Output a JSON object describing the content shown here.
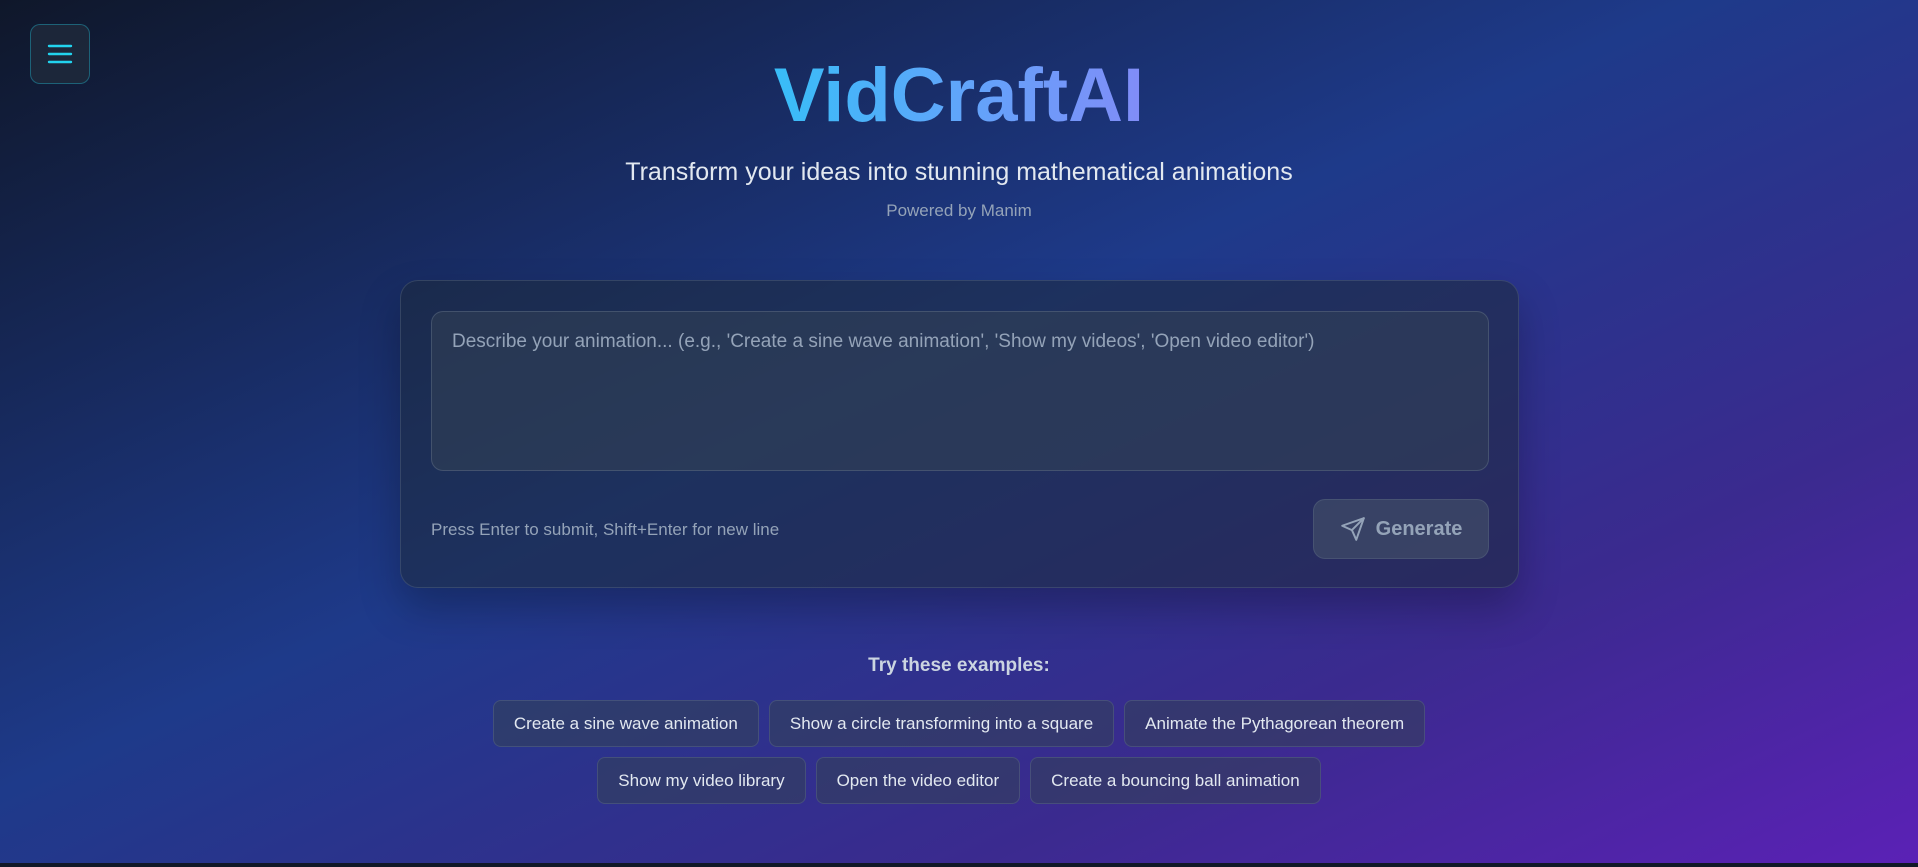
{
  "header": {
    "title": "VidCraftAI",
    "subtitle": "Transform your ideas into stunning mathematical animations",
    "powered_by": "Powered by Manim"
  },
  "menu": {
    "icon": "menu-icon"
  },
  "prompt": {
    "value": "",
    "placeholder": "Describe your animation... (e.g., 'Create a sine wave animation', 'Show my videos', 'Open video editor')",
    "hint": "Press Enter to submit, Shift+Enter for new line",
    "generate_label": "Generate",
    "generate_icon": "send-icon"
  },
  "examples": {
    "heading": "Try these examples:",
    "rows": [
      [
        "Create a sine wave animation",
        "Show a circle transforming into a square",
        "Animate the Pythagorean theorem"
      ],
      [
        "Show my video library",
        "Open the video editor",
        "Create a bouncing ball animation"
      ]
    ]
  },
  "colors": {
    "accent": "#22d3ee",
    "title_gradient_start": "#38bdf8",
    "title_gradient_end": "#818cf8"
  }
}
